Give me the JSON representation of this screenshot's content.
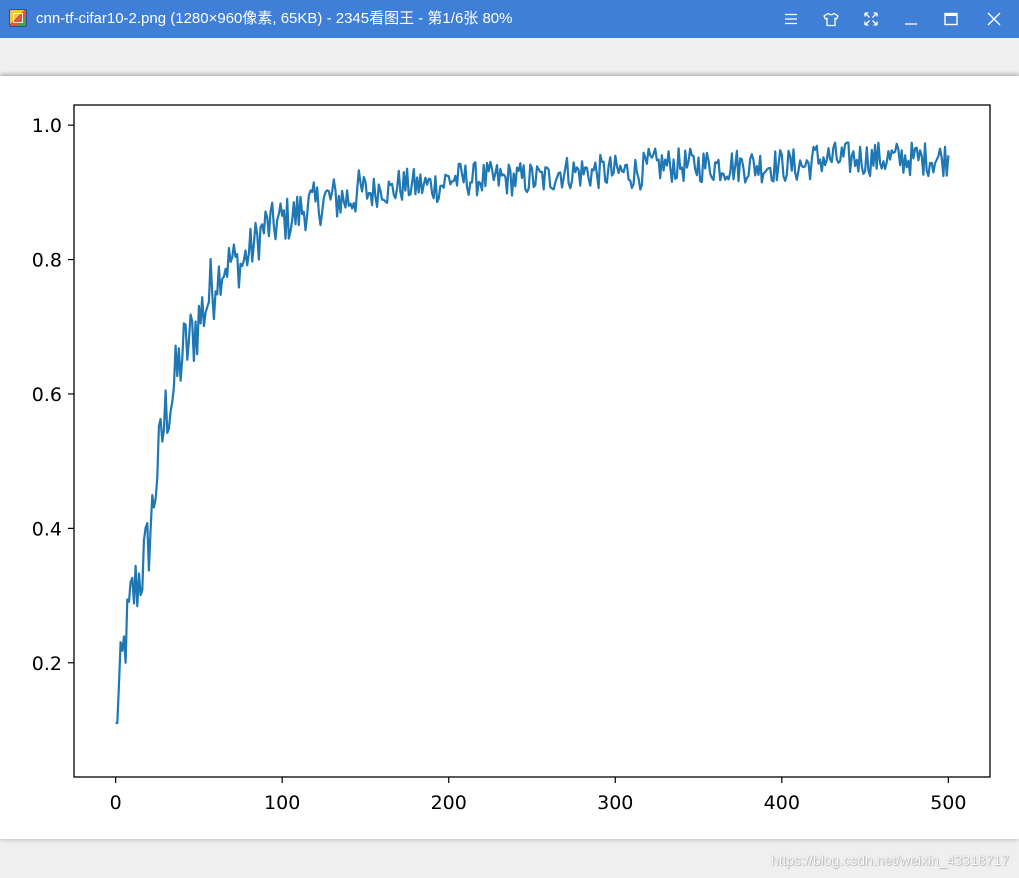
{
  "window": {
    "title": "cnn-tf-cifar10-2.png  (1280×960像素, 65KB)  - 2345看图王 - 第1/6张 80%",
    "controls": [
      "menu-icon",
      "skin-icon",
      "fullscreen-icon",
      "minimize-icon",
      "maximize-icon",
      "close-icon"
    ]
  },
  "watermark": "https://blog.csdn.net/weixin_43318717",
  "colors": {
    "titlebar": "#3f7fd8",
    "series": "#1f77b4",
    "canvas": "#ffffff",
    "viewer_bg": "#efefef"
  },
  "chart_data": {
    "type": "line",
    "xlim": [
      -25,
      525
    ],
    "ylim": [
      0.03,
      1.03
    ],
    "xticks": [
      0,
      100,
      200,
      300,
      400,
      500
    ],
    "yticks": [
      0.2,
      0.4,
      0.6,
      0.8,
      1.0
    ],
    "xticklabels": [
      "0",
      "100",
      "200",
      "300",
      "400",
      "500"
    ],
    "yticklabels": [
      "0.2",
      "0.4",
      "0.6",
      "0.8",
      "1.0"
    ],
    "grid": false,
    "series": [
      {
        "x_start": 0,
        "x_step": 5,
        "values": [
          0.11,
          0.22,
          0.3,
          0.33,
          0.38,
          0.49,
          0.57,
          0.61,
          0.66,
          0.68,
          0.71,
          0.74,
          0.77,
          0.79,
          0.8,
          0.79,
          0.81,
          0.83,
          0.85,
          0.85,
          0.86,
          0.86,
          0.87,
          0.88,
          0.88,
          0.89,
          0.89,
          0.89,
          0.89,
          0.9,
          0.9,
          0.9,
          0.91,
          0.9,
          0.91,
          0.91,
          0.91,
          0.91,
          0.91,
          0.91,
          0.92,
          0.92,
          0.92,
          0.92,
          0.92,
          0.92,
          0.92,
          0.92,
          0.92,
          0.92,
          0.92,
          0.92,
          0.92,
          0.93,
          0.93,
          0.93,
          0.93,
          0.93,
          0.93,
          0.93,
          0.93,
          0.93,
          0.93,
          0.93,
          0.94,
          0.94,
          0.94,
          0.94,
          0.94,
          0.94,
          0.94,
          0.94,
          0.94,
          0.94,
          0.94,
          0.94,
          0.94,
          0.94,
          0.94,
          0.94,
          0.94,
          0.94,
          0.94,
          0.94,
          0.95,
          0.95,
          0.95,
          0.95,
          0.95,
          0.95,
          0.95,
          0.95,
          0.95,
          0.95,
          0.95,
          0.95,
          0.95,
          0.95,
          0.95,
          0.95,
          0.95
        ]
      }
    ]
  }
}
